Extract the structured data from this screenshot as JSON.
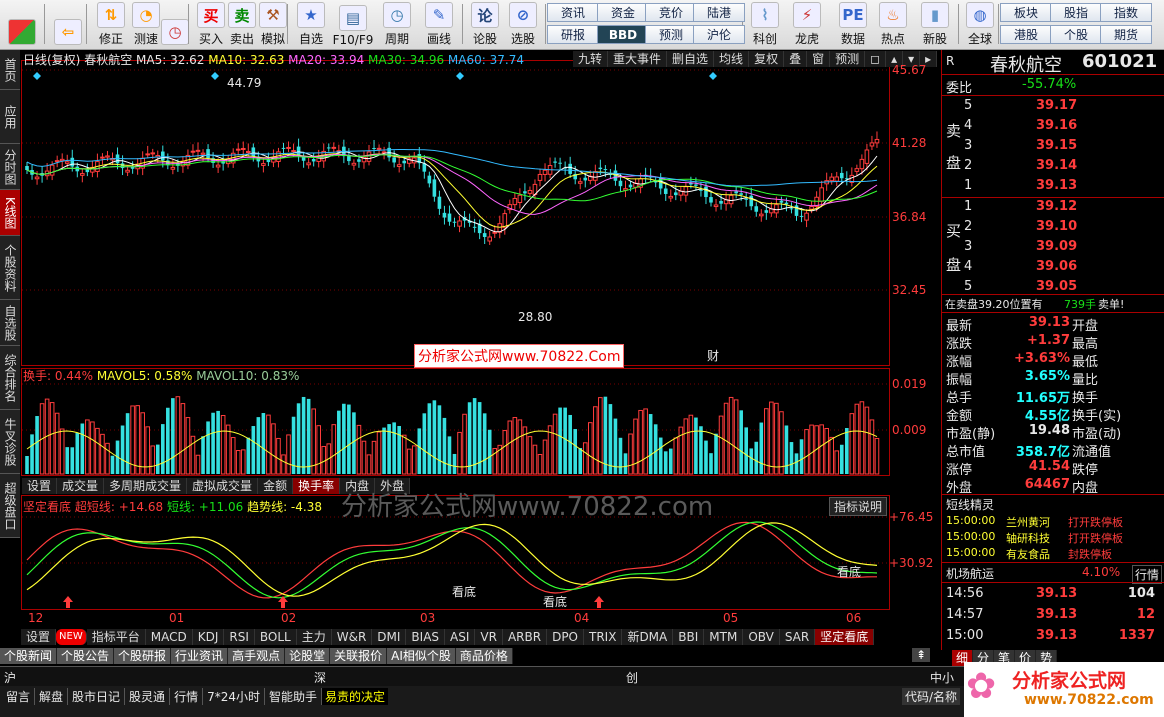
{
  "toolbar": {
    "tools": [
      {
        "label": "",
        "icon": "window-icon"
      },
      {
        "label": "",
        "icon": "back-arrow-icon"
      },
      {
        "label": "修正",
        "icon": "up-down-arrows-icon"
      },
      {
        "label": "测速",
        "icon": "speed-icon"
      },
      {
        "label": "",
        "icon": "clock-icon"
      },
      {
        "label": "买入",
        "icon": "buy-icon",
        "glyph": "买"
      },
      {
        "label": "卖出",
        "icon": "sell-icon",
        "glyph": "卖"
      },
      {
        "label": "模拟",
        "icon": "hammer-icon"
      },
      {
        "label": "自选",
        "icon": "star-icon"
      },
      {
        "label": "F10/F9",
        "icon": "f10-icon"
      },
      {
        "label": "周期",
        "icon": "period-icon"
      },
      {
        "label": "画线",
        "icon": "pencil-icon"
      },
      {
        "label": "论股",
        "icon": "lungu-icon",
        "glyph": "论"
      },
      {
        "label": "选股",
        "icon": "select-stock-icon"
      },
      {
        "label": "科创",
        "icon": "kechuang-icon"
      },
      {
        "label": "龙虎",
        "icon": "longhu-icon"
      },
      {
        "label": "数据",
        "icon": "pe-icon",
        "glyph": "PE"
      },
      {
        "label": "热点",
        "icon": "hot-icon"
      },
      {
        "label": "新股",
        "icon": "newstock-icon"
      },
      {
        "label": "全球",
        "icon": "globe-icon"
      }
    ],
    "quick_buttons": [
      "资讯",
      "资金",
      "竞价",
      "陆港",
      "研报",
      "BBD",
      "预测",
      "沪伦",
      "板块",
      "股指",
      "指数",
      "港股",
      "个股",
      "期货"
    ]
  },
  "left_nav": [
    "首页",
    "应用",
    "分时图",
    "K线图",
    "个股资料",
    "自选股",
    "综合排名",
    "牛叉诊股",
    "超级盘口"
  ],
  "chart": {
    "header": {
      "period": "日线(复权)",
      "stock": "春秋航空",
      "ma5": "MA5: 32.62",
      "ma10": "MA10: 32.63",
      "ma20": "MA20: 33.94",
      "ma30": "MA30: 34.96",
      "ma60": "MA60: 37.74"
    },
    "header_buttons": [
      "九转",
      "重大事件",
      "删自选",
      "均线",
      "复权",
      "叠",
      "窗",
      "预测"
    ],
    "y_axis_price": [
      "45.67",
      "41.28",
      "36.84",
      "32.45"
    ],
    "y_axis_volume": [
      "0.019",
      "0.009"
    ],
    "y_axis_indicator": [
      "+76.45",
      "+30.92"
    ],
    "high_label": "44.79",
    "low_label": "28.80",
    "caption": "分析家公式网www.70822.Com",
    "event_marker": "财",
    "watermark": "分析家公式网www.70822.com",
    "volume_header": {
      "turnover": "换手: 0.44%",
      "mavol5": "MAVOL5: 0.58%",
      "mavol10": "MAVOL10: 0.83%"
    },
    "volume_tabs": [
      "设置",
      "成交量",
      "多周期成交量",
      "虚拟成交量",
      "金额",
      "换手率",
      "内盘",
      "外盘"
    ],
    "indicator_header": {
      "name": "坚定看底",
      "super": "超短线: +14.68",
      "short": "短线: +11.06",
      "trend": "趋势线: -4.38"
    },
    "indicator_help": "指标说明",
    "indicator_labels": [
      "看底",
      "看底",
      "看底"
    ],
    "x_axis": [
      "12",
      "01",
      "02",
      "03",
      "04",
      "05",
      "06"
    ],
    "indicator_tabs": [
      "设置",
      "指标平台",
      "MACD",
      "KDJ",
      "RSI",
      "BOLL",
      "主力",
      "W&R",
      "DMI",
      "BIAS",
      "ASI",
      "VR",
      "ARBR",
      "DPO",
      "TRIX",
      "新DMA",
      "BBI",
      "MTM",
      "OBV",
      "SAR",
      "坚定看底"
    ],
    "new_badge": "NEW",
    "colors": {
      "up": "#ff3c3c",
      "down": "#35e0e0",
      "ma5": "#ffffff",
      "ma10": "#ffff33",
      "ma20": "#ff66ff",
      "ma30": "#33ff33",
      "ma60": "#33bbff"
    }
  },
  "bottom_tabs": [
    "个股新闻",
    "个股公告",
    "个股研报",
    "行业资讯",
    "高手观点",
    "论股堂",
    "关联报价",
    "AI相似个股",
    "商品价格"
  ],
  "market_bar": [
    "沪",
    "深",
    "创",
    "中小"
  ],
  "status_bar": [
    "留言",
    "解盘",
    "股市日记",
    "股灵通",
    "行情",
    "7*24小时",
    "智能助手"
  ],
  "status_highlight": "易责的决定",
  "status_right": "代码/名称",
  "quote": {
    "market": "R",
    "name": "春秋航空",
    "code": "601021",
    "weibi_label": "委比",
    "weibi_value": "-55.74%",
    "sell_label": [
      "卖",
      "盘"
    ],
    "buy_label": [
      "买",
      "盘"
    ],
    "sell": [
      [
        "5",
        "39.17"
      ],
      [
        "4",
        "39.16"
      ],
      [
        "3",
        "39.15"
      ],
      [
        "2",
        "39.14"
      ],
      [
        "1",
        "39.13"
      ]
    ],
    "buy": [
      [
        "1",
        "39.12"
      ],
      [
        "2",
        "39.10"
      ],
      [
        "3",
        "39.09"
      ],
      [
        "4",
        "39.06"
      ],
      [
        "5",
        "39.05"
      ]
    ],
    "notice_left": "在卖盘39.20位置有",
    "notice_qty": "739手",
    "notice_right": "卖单!",
    "stats": [
      [
        "最新",
        "39.13",
        "开盘",
        ""
      ],
      [
        "涨跌",
        "+1.37",
        "最高",
        ""
      ],
      [
        "涨幅",
        "+3.63%",
        "最低",
        ""
      ],
      [
        "振幅",
        "3.65%",
        "量比",
        ""
      ],
      [
        "总手",
        "11.65万",
        "换手",
        ""
      ],
      [
        "金额",
        "4.55亿",
        "换手(实)",
        ""
      ],
      [
        "市盈(静)",
        "19.48",
        "市盈(动)",
        ""
      ],
      [
        "总市值",
        "358.7亿",
        "流通值",
        ""
      ],
      [
        "涨停",
        "41.54",
        "跌停",
        ""
      ],
      [
        "外盘",
        "64467",
        "内盘",
        ""
      ]
    ],
    "flash_title": "短线精灵",
    "flash": [
      [
        "15:00:00",
        "兰州黄河",
        "打开跌停板"
      ],
      [
        "15:00:00",
        "轴研科技",
        "打开跌停板"
      ],
      [
        "15:00:00",
        "有友食品",
        "封跌停板"
      ]
    ],
    "sector": "机场航运",
    "sector_change": "4.10%",
    "sector_btn": "行情",
    "ticks": [
      [
        "14:56",
        "39.13",
        "104"
      ],
      [
        "14:57",
        "39.13",
        "12"
      ],
      [
        "15:00",
        "39.13",
        "1337"
      ]
    ],
    "tabs": [
      "细",
      "分",
      "笔",
      "价",
      "势"
    ]
  },
  "logo": {
    "name": "分析家公式网",
    "url": "www.70822.com"
  }
}
